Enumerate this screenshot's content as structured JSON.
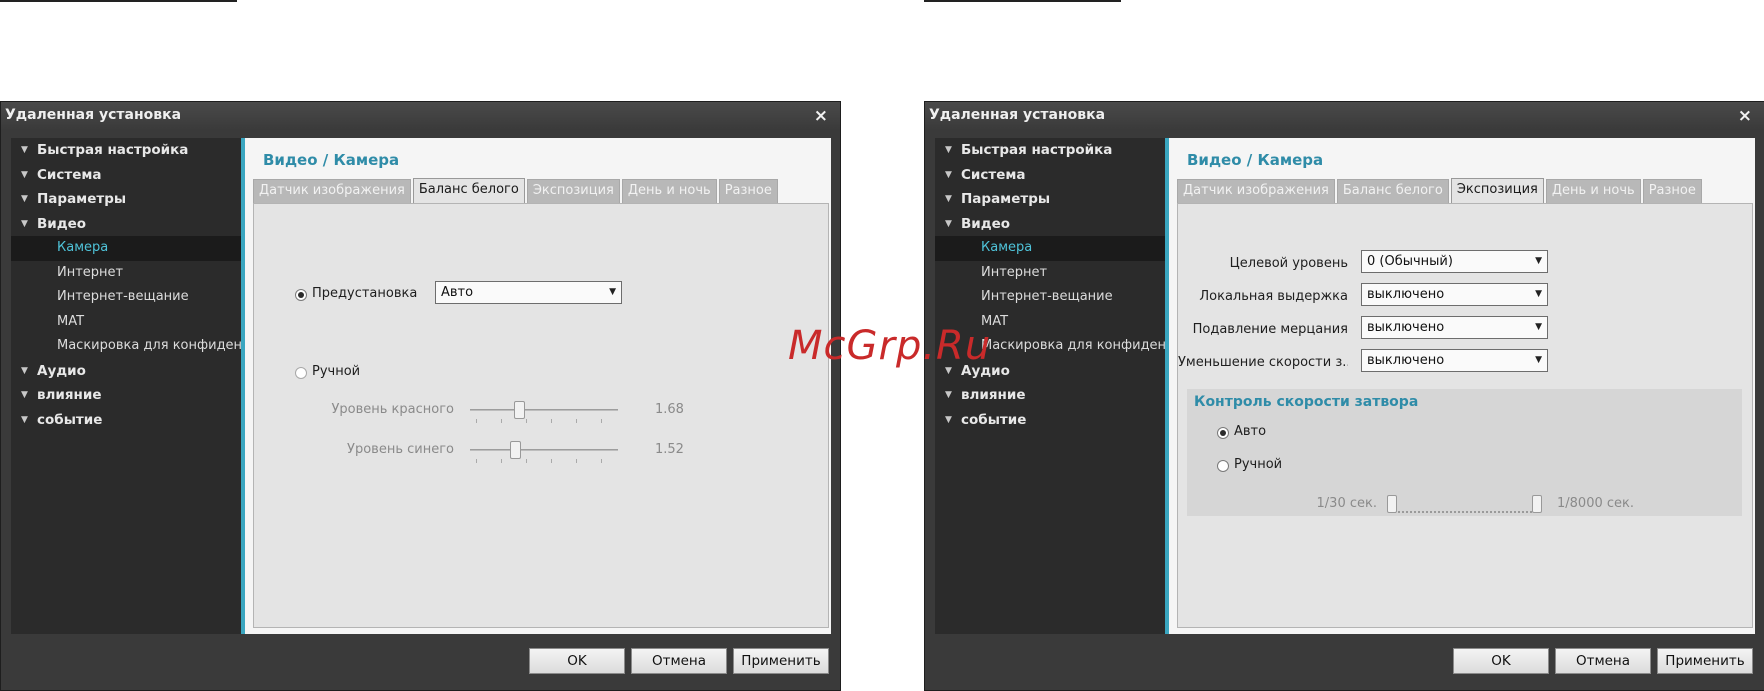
{
  "watermark": "McGrp.Ru",
  "dialogs": [
    {
      "title": "Удаленная установка",
      "close_glyph": "×",
      "tree": [
        {
          "label": "Быстрая настройка"
        },
        {
          "label": "Система"
        },
        {
          "label": "Параметры"
        },
        {
          "label": "Видео"
        },
        {
          "label": "Камера"
        },
        {
          "label": "Интернет"
        },
        {
          "label": "Интернет-вещание"
        },
        {
          "label": "MAT"
        },
        {
          "label": "Маскировка для конфиденциальности"
        },
        {
          "label": "Аудио"
        },
        {
          "label": "влияние"
        },
        {
          "label": "событие"
        }
      ],
      "content_title": "Видео / Камера",
      "tabs": [
        "Датчик изображения",
        "Баланс белого",
        "Экспозиция",
        "День и ночь",
        "Разное"
      ],
      "active_tab": "Баланс белого",
      "preset_label": "Предустановка",
      "preset_value": "Авто",
      "manual_label": "Ручной",
      "red_label": "Уровень красного",
      "red_value": "1.68",
      "blue_label": "Уровень синего",
      "blue_value": "1.52",
      "buttons": {
        "ok": "OK",
        "cancel": "Отмена",
        "apply": "Применить"
      }
    },
    {
      "title": "Удаленная установка",
      "close_glyph": "×",
      "tree": [
        {
          "label": "Быстрая настройка"
        },
        {
          "label": "Система"
        },
        {
          "label": "Параметры"
        },
        {
          "label": "Видео"
        },
        {
          "label": "Камера"
        },
        {
          "label": "Интернет"
        },
        {
          "label": "Интернет-вещание"
        },
        {
          "label": "MAT"
        },
        {
          "label": "Маскировка для конфиденциальности"
        },
        {
          "label": "Аудио"
        },
        {
          "label": "влияние"
        },
        {
          "label": "событие"
        }
      ],
      "content_title": "Видео / Камера",
      "tabs": [
        "Датчик изображения",
        "Баланс белого",
        "Экспозиция",
        "День и ночь",
        "Разное"
      ],
      "active_tab": "Экспозиция",
      "fields": [
        {
          "label": "Целевой уровень",
          "value": "0 (Обычный)"
        },
        {
          "label": "Локальная выдержка",
          "value": "выключено"
        },
        {
          "label": "Подавление мерцания",
          "value": "выключено"
        },
        {
          "label": "Уменьшение скорости з...",
          "value": "выключено"
        }
      ],
      "shutter_title": "Контроль скорости затвора",
      "auto_label": "Авто",
      "manual_label": "Ручной",
      "shutter_min": "1/30 сек.",
      "shutter_max": "1/8000 сек.",
      "buttons": {
        "ok": "OK",
        "cancel": "Отмена",
        "apply": "Применить"
      }
    }
  ]
}
